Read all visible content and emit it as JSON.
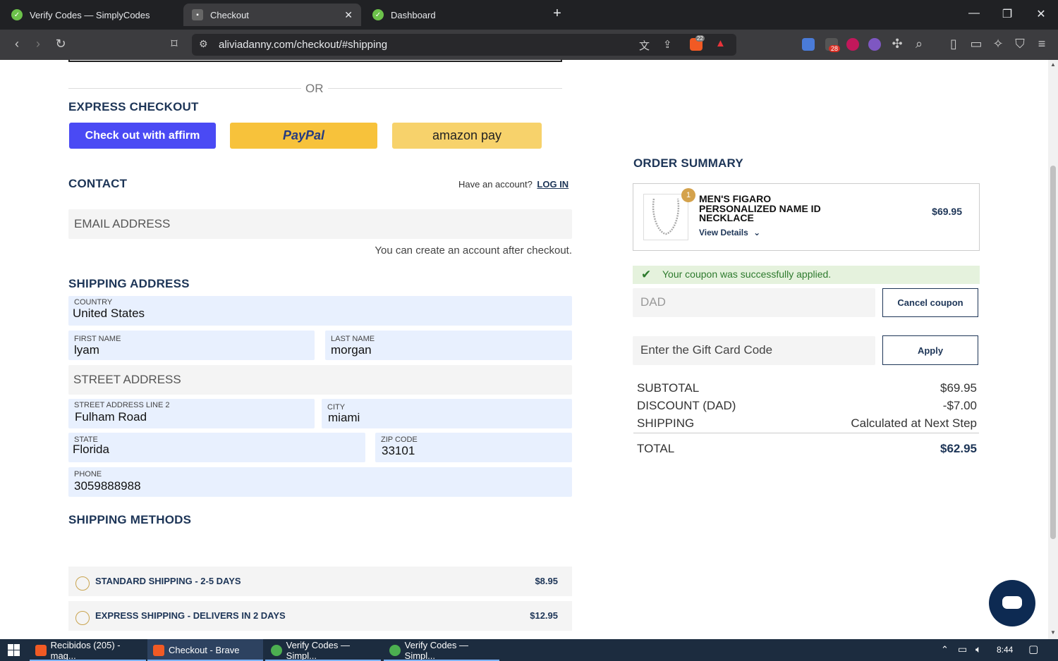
{
  "browser": {
    "tabs": [
      {
        "label": "Verify Codes — SimplyCodes",
        "active": false
      },
      {
        "label": "Checkout",
        "active": true
      },
      {
        "label": "Dashboard",
        "active": false
      }
    ],
    "new_tab": "+",
    "url": "aliviadanny.com/checkout/#shipping",
    "ext_badge_count": "28",
    "brave_badge": "22"
  },
  "page": {
    "or_divider": "OR",
    "express_title": "EXPRESS CHECKOUT",
    "affirm_label": "Check out with affirm",
    "paypal_label": "PayPal",
    "amazon_label": "amazon pay",
    "contact_title": "CONTACT",
    "have_account": "Have an account?",
    "login_link": "LOG IN",
    "email_placeholder": "EMAIL ADDRESS",
    "create_account_note": "You can create an account after checkout.",
    "shipping_title": "SHIPPING ADDRESS",
    "country": {
      "label": "COUNTRY",
      "value": "United States"
    },
    "first_name": {
      "label": "FIRST NAME",
      "value": "lyam"
    },
    "last_name": {
      "label": "LAST NAME",
      "value": "morgan"
    },
    "street_placeholder": "STREET ADDRESS",
    "street2": {
      "label": "STREET ADDRESS LINE 2",
      "value": "Fulham Road"
    },
    "city": {
      "label": "CITY",
      "value": "miami"
    },
    "state": {
      "label": "STATE",
      "value": "Florida"
    },
    "zip": {
      "label": "ZIP CODE",
      "value": "33101"
    },
    "phone": {
      "label": "PHONE",
      "value": "3059888988"
    },
    "methods_title": "SHIPPING METHODS",
    "methods": [
      {
        "name": "STANDARD SHIPPING - 2-5 DAYS",
        "price": "$8.95"
      },
      {
        "name": "EXPRESS SHIPPING - DELIVERS IN 2 DAYS",
        "price": "$12.95"
      }
    ]
  },
  "summary": {
    "title": "ORDER SUMMARY",
    "item": {
      "qty": "1",
      "name_line1": "MEN'S FIGARO",
      "name_line2": "PERSONALIZED NAME ID",
      "name_line3": "NECKLACE",
      "details": "View Details",
      "price": "$69.95"
    },
    "coupon_success": "Your coupon was successfully applied.",
    "coupon_value": "DAD",
    "cancel_coupon": "Cancel coupon",
    "gift_placeholder": "Enter the Gift Card Code",
    "apply": "Apply",
    "subtotal_label": "SUBTOTAL",
    "subtotal_value": "$69.95",
    "discount_label": "DISCOUNT (DAD)",
    "discount_value": "-$7.00",
    "shipping_label": "SHIPPING",
    "shipping_value": "Calculated at Next Step",
    "total_label": "TOTAL",
    "total_value": "$62.95"
  },
  "taskbar": {
    "items": [
      {
        "label": "Recibidos (205) - mag..."
      },
      {
        "label": "Checkout - Brave"
      },
      {
        "label": "Verify Codes — Simpl..."
      },
      {
        "label": "Verify Codes — Simpl..."
      }
    ],
    "time": "8:44"
  },
  "colors": {
    "navy": "#1d3557",
    "affirm": "#4a4af4",
    "paypal": "#f7c23b",
    "amazon": "#f7d26b",
    "success_bg": "#e5f2dd",
    "autofill_bg": "#e8f0fe"
  }
}
